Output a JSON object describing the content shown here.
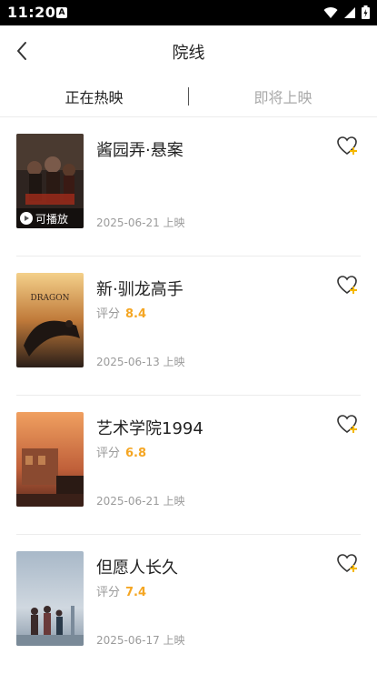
{
  "status_bar": {
    "time": "11:20",
    "notification_icon": "app-notification-icon",
    "icons": [
      "wifi-icon",
      "signal-icon",
      "battery-icon"
    ]
  },
  "header": {
    "back_icon": "back-chevron-icon",
    "title": "院线"
  },
  "tabs": [
    {
      "label": "正在热映",
      "active": true
    },
    {
      "label": "即将上映",
      "active": false
    }
  ],
  "movies": [
    {
      "title": "酱园弄·悬案",
      "rating_label": "",
      "rating": "",
      "release": "2025-06-21 上映",
      "play_badge": "可播放",
      "poster_colors": [
        "#3a2a22",
        "#8b3a2a"
      ]
    },
    {
      "title": "新·驯龙高手",
      "rating_label": "评分",
      "rating": "8.4",
      "release": "2025-06-13 上映",
      "play_badge": "",
      "poster_colors": [
        "#f0c070",
        "#3a2a20"
      ]
    },
    {
      "title": "艺术学院1994",
      "rating_label": "评分",
      "rating": "6.8",
      "release": "2025-06-21 上映",
      "play_badge": "",
      "poster_colors": [
        "#e07a3a",
        "#7a3a2a"
      ]
    },
    {
      "title": "但愿人长久",
      "rating_label": "评分",
      "rating": "7.4",
      "release": "2025-06-17 上映",
      "play_badge": "",
      "poster_colors": [
        "#b8c4d0",
        "#6a7a8a"
      ]
    }
  ],
  "colors": {
    "rating": "#f5a623",
    "favorite_plus": "#f5b800",
    "active_tab": "#222222",
    "inactive_tab": "#aaaaaa"
  }
}
